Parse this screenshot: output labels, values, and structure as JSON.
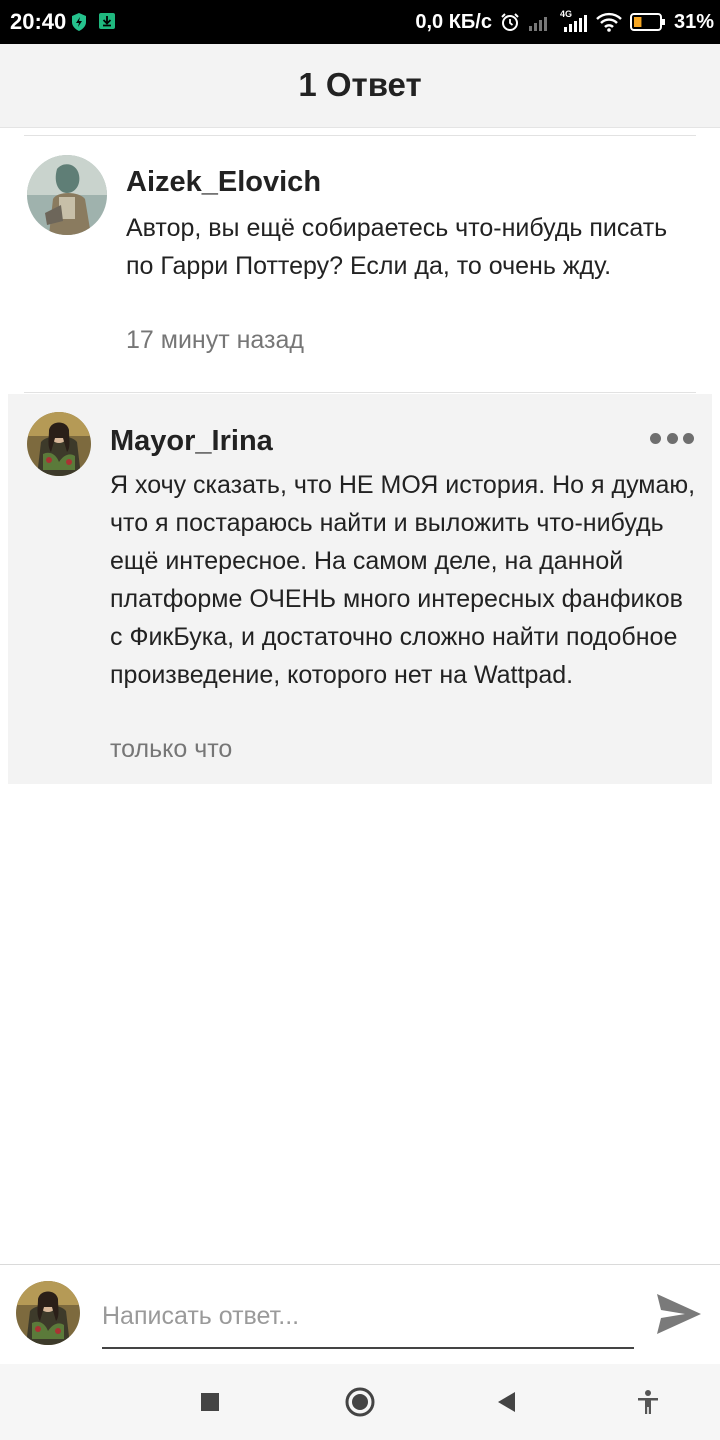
{
  "status_bar": {
    "time": "20:40",
    "network_speed": "0,0 КБ/с",
    "network_type": "4G",
    "battery_percent": "31%",
    "battery_level": 0.31,
    "icons": [
      "shield-bolt-icon",
      "download-icon",
      "alarm-icon",
      "signal-icon",
      "wifi-icon",
      "battery-icon"
    ]
  },
  "header": {
    "title": "1 Ответ"
  },
  "comments": [
    {
      "username": "Aizek_Elovich",
      "text": "Автор, вы ещё собираетесь что-нибудь писать по Гарри Поттеру? Если да, то очень жду.",
      "time": "17 минут назад"
    },
    {
      "username": "Mayor_Irina",
      "text": "Я хочу сказать, что НЕ МОЯ история. Но я думаю, что я постараюсь найти и выложить что-нибудь ещё интересное. На самом деле, на данной платформе ОЧЕНЬ много интересных фанфиков с ФикБука, и достаточно сложно найти подобное произведение, которого нет на Wattpad.",
      "time": "только что",
      "menu_icon": "more-dots-icon"
    }
  ],
  "reply": {
    "placeholder": "Написать ответ...",
    "value": "",
    "send_icon": "send-icon"
  },
  "nav": {
    "icons": [
      "square-icon",
      "circle-home-icon",
      "back-triangle-icon",
      "accessibility-icon"
    ]
  },
  "colors": {
    "status_bar_bg": "#000000",
    "header_bg": "#f3f3f3",
    "highlight_bg": "#f3f3f3",
    "text": "#222222",
    "muted_text": "#767676",
    "battery_fill": "#f5a623"
  }
}
